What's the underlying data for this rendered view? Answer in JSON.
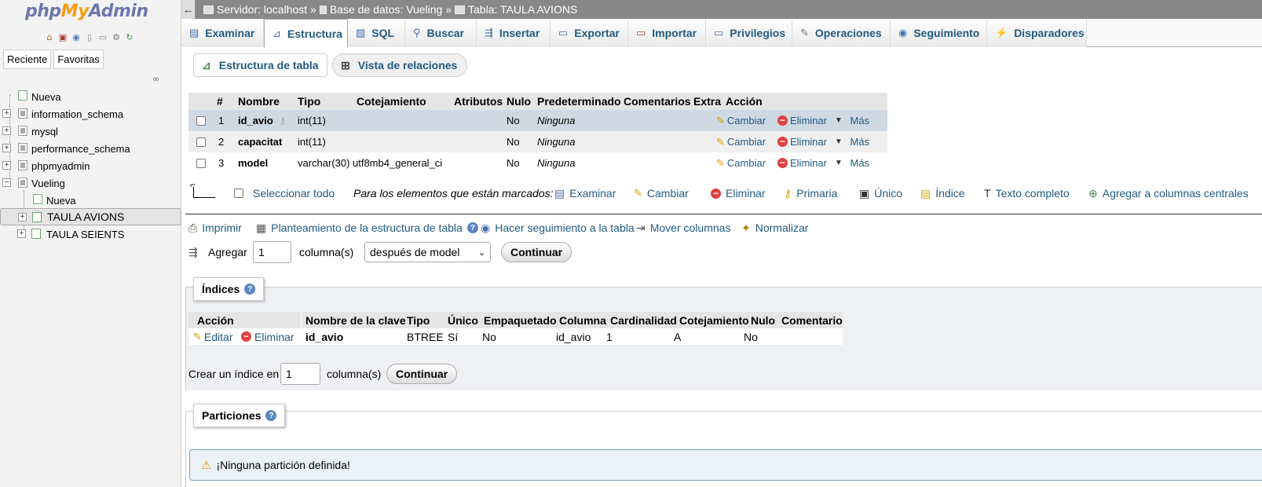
{
  "nav": {
    "logo_php": "php",
    "logo_my": "My",
    "logo_admin": "Admin",
    "quick_icons": [
      "home-icon",
      "exit-icon",
      "help-icon",
      "docs-icon",
      "copy-icon",
      "settings-icon",
      "reload-icon"
    ],
    "tab_recent": "Reciente",
    "tab_favorites": "Favoritas",
    "tree": [
      {
        "label": "Nueva",
        "kind": "new"
      },
      {
        "label": "information_schema",
        "kind": "db"
      },
      {
        "label": "mysql",
        "kind": "db"
      },
      {
        "label": "performance_schema",
        "kind": "db"
      },
      {
        "label": "phpmyadmin",
        "kind": "db"
      },
      {
        "label": "Vueling",
        "kind": "db-open"
      },
      {
        "label": "Nueva",
        "kind": "new-child"
      },
      {
        "label": "TAULA AVIONS",
        "kind": "table-selected"
      },
      {
        "label": "TAULA SEIENTS",
        "kind": "table"
      }
    ]
  },
  "breadcrumb": {
    "server": "Servidor: localhost »",
    "database": "Base de datos: Vueling »",
    "table": "Tabla: TAULA AVIONS"
  },
  "tabs": [
    {
      "label": "Examinar",
      "icon": "browse-icon"
    },
    {
      "label": "Estructura",
      "icon": "structure-icon"
    },
    {
      "label": "SQL",
      "icon": "sql-icon"
    },
    {
      "label": "Buscar",
      "icon": "search-icon"
    },
    {
      "label": "Insertar",
      "icon": "insert-icon"
    },
    {
      "label": "Exportar",
      "icon": "export-icon"
    },
    {
      "label": "Importar",
      "icon": "import-icon"
    },
    {
      "label": "Privilegios",
      "icon": "privileges-icon"
    },
    {
      "label": "Operaciones",
      "icon": "wrench-icon"
    },
    {
      "label": "Seguimiento",
      "icon": "eye-icon"
    },
    {
      "label": "Disparadores",
      "icon": "triggers-icon"
    }
  ],
  "active_tab": "Estructura",
  "subtabs": {
    "structure": "Estructura de tabla",
    "relations": "Vista de relaciones"
  },
  "structure": {
    "headers": [
      "#",
      "Nombre",
      "Tipo",
      "Cotejamiento",
      "Atributos",
      "Nulo",
      "Predeterminado",
      "Comentarios",
      "Extra",
      "Acción"
    ],
    "rows": [
      {
        "num": "1",
        "name": "id_avio",
        "type": "int(11)",
        "collation": "",
        "attributes": "",
        "null": "No",
        "default": "Ninguna",
        "comments": "",
        "extra": "",
        "primary_key": true
      },
      {
        "num": "2",
        "name": "capacitat",
        "type": "int(11)",
        "collation": "",
        "attributes": "",
        "null": "No",
        "default": "Ninguna",
        "comments": "",
        "extra": "",
        "primary_key": false
      },
      {
        "num": "3",
        "name": "model",
        "type": "varchar(30)",
        "collation": "utf8mb4_general_ci",
        "attributes": "",
        "null": "No",
        "default": "Ninguna",
        "comments": "",
        "extra": "",
        "primary_key": false
      }
    ],
    "action_change": "Cambiar",
    "action_drop": "Eliminar",
    "action_more": "Más"
  },
  "bulk": {
    "select_all": "Seleccionar todo",
    "with_selected": "Para los elementos que están marcados:",
    "browse": "Examinar",
    "change": "Cambiar",
    "drop": "Eliminar",
    "primary": "Primaria",
    "unique": "Único",
    "index": "Índice",
    "fulltext": "Texto completo",
    "central": "Agregar a columnas centrales"
  },
  "tools": {
    "print": "Imprimir",
    "propose": "Planteamiento de la estructura de tabla",
    "track": "Hacer seguimiento a la tabla",
    "move": "Mover columnas",
    "normalize": "Normalizar"
  },
  "add_column": {
    "label": "Agregar",
    "count": "1",
    "unit": "columna(s)",
    "position": "después de model",
    "go": "Continuar"
  },
  "indexes": {
    "legend": "Índices",
    "headers": [
      "Acción",
      "Nombre de la clave",
      "Tipo",
      "Único",
      "Empaquetado",
      "Columna",
      "Cardinalidad",
      "Cotejamiento",
      "Nulo",
      "Comentario"
    ],
    "row": {
      "edit": "Editar",
      "drop": "Eliminar",
      "key_name": "id_avio",
      "type": "BTREE",
      "unique": "Sí",
      "packed": "No",
      "column": "id_avio",
      "cardinality": "1",
      "collation": "A",
      "null": "No",
      "comment": ""
    },
    "create_label": "Crear un índice en",
    "create_count": "1",
    "create_unit": "columna(s)",
    "create_go": "Continuar"
  },
  "partitions": {
    "legend": "Particiones",
    "notice": "¡Ninguna partición definida!"
  }
}
